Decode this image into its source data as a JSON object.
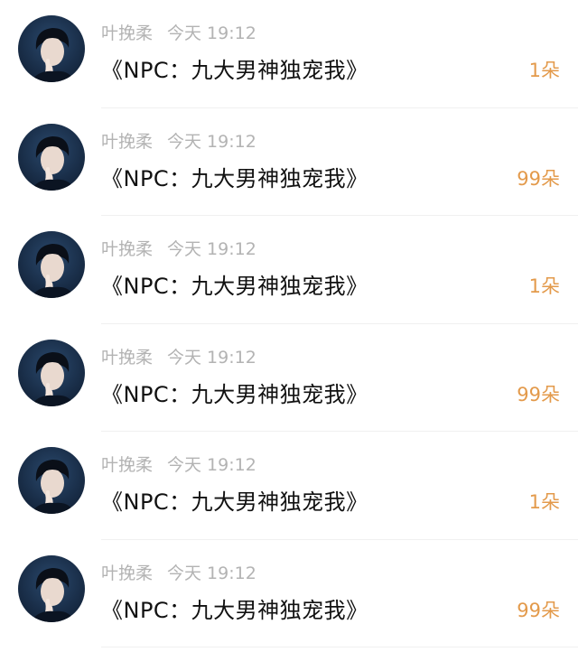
{
  "messages": [
    {
      "sender": "叶挽柔",
      "time": "今天 19:12",
      "title": "《NPC：九大男神独宠我》",
      "count": "1朵"
    },
    {
      "sender": "叶挽柔",
      "time": "今天 19:12",
      "title": "《NPC：九大男神独宠我》",
      "count": "99朵"
    },
    {
      "sender": "叶挽柔",
      "time": "今天 19:12",
      "title": "《NPC：九大男神独宠我》",
      "count": "1朵"
    },
    {
      "sender": "叶挽柔",
      "time": "今天 19:12",
      "title": "《NPC：九大男神独宠我》",
      "count": "99朵"
    },
    {
      "sender": "叶挽柔",
      "time": "今天 19:12",
      "title": "《NPC：九大男神独宠我》",
      "count": "1朵"
    },
    {
      "sender": "叶挽柔",
      "time": "今天 19:12",
      "title": "《NPC：九大男神独宠我》",
      "count": "99朵"
    }
  ],
  "colors": {
    "sender_text": "#b3b3b3",
    "title_text": "#111111",
    "count_accent": "#e39a4b",
    "avatar_bg": "#1a2f4a"
  },
  "icons": {
    "avatar": "user-avatar-photo"
  }
}
